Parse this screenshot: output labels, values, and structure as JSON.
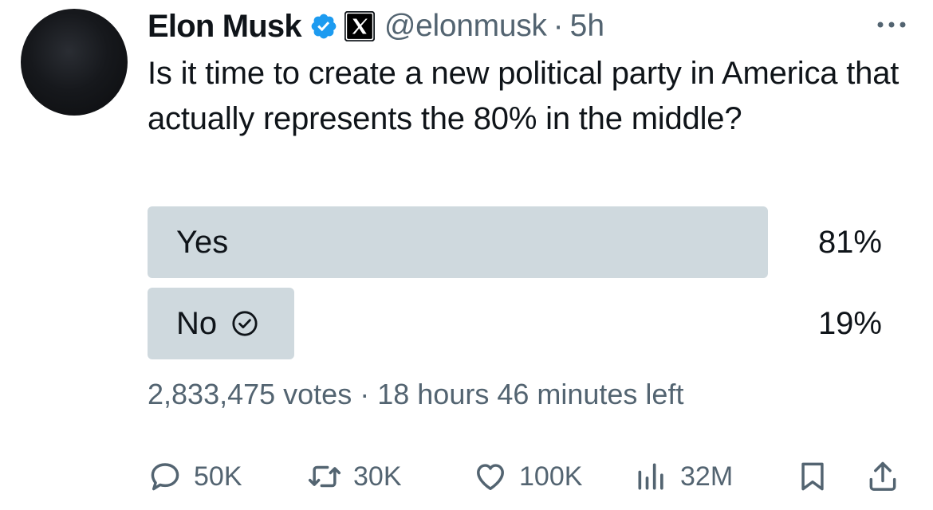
{
  "author": {
    "name": "Elon Musk",
    "handle": "@elonmusk",
    "separator": "·",
    "time": "5h"
  },
  "tweet": {
    "text": "Is it time to create a new political party in America that actually represents the 80% in the middle?"
  },
  "poll": {
    "options": [
      {
        "label": "Yes",
        "percent_text": "81%",
        "fill": 0.845,
        "selected": false
      },
      {
        "label": "No",
        "percent_text": "19%",
        "fill": 0.2,
        "selected": true
      }
    ],
    "votes": "2,833,475 votes",
    "separator": "·",
    "time_left": "18 hours 46 minutes left"
  },
  "actions": {
    "reply_count": "50K",
    "retweet_count": "30K",
    "like_count": "100K",
    "views_count": "32M"
  },
  "icons": {
    "verified": "verified-badge-icon",
    "x_badge": "x-logo-icon",
    "more": "more-icon",
    "selected_check": "check-circle-icon",
    "reply": "reply-icon",
    "retweet": "retweet-icon",
    "like": "heart-icon",
    "views": "views-icon",
    "bookmark": "bookmark-icon",
    "share": "share-icon"
  },
  "colors": {
    "text": "#0f1419",
    "secondary": "#536471",
    "verified_blue": "#1d9bf0",
    "poll_bar": "#cfd9de"
  }
}
